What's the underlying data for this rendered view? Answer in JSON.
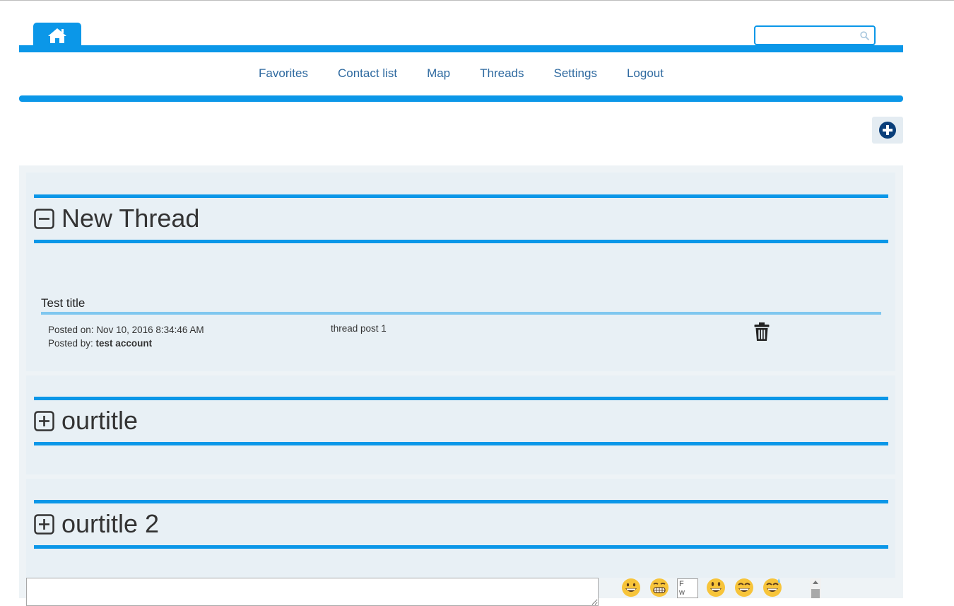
{
  "header": {
    "home_icon": "home-icon",
    "search": {
      "placeholder": "",
      "value": "",
      "icon": "search-icon"
    }
  },
  "nav": {
    "items": [
      {
        "label": "Favorites"
      },
      {
        "label": "Contact list"
      },
      {
        "label": "Map"
      },
      {
        "label": "Threads"
      },
      {
        "label": "Settings"
      },
      {
        "label": "Logout"
      }
    ]
  },
  "toolbar": {
    "add_icon": "plus-circle-icon"
  },
  "threads": [
    {
      "title": "New Thread",
      "expanded": true,
      "toggle_icon": "minus-square-icon",
      "posts": [
        {
          "title": "Test title",
          "posted_on_label": "Posted on: ",
          "posted_on": "Nov 10, 2016 8:34:46 AM",
          "posted_by_label": "Posted by: ",
          "posted_by": "test account",
          "body": "thread post 1",
          "delete_icon": "trash-icon"
        }
      ]
    },
    {
      "title": "ourtitle",
      "expanded": false,
      "toggle_icon": "plus-square-icon",
      "posts": []
    },
    {
      "title": "ourtitle 2",
      "expanded": false,
      "toggle_icon": "plus-square-icon",
      "posts": []
    }
  ],
  "compose": {
    "value": "",
    "emojis": [
      "grinning-face-icon",
      "grimacing-face-icon",
      "broken-image",
      "smiley-face-icon",
      "smile-face-icon",
      "sweat-smile-face-icon"
    ],
    "broken_image_alt": "F\nw"
  },
  "colors": {
    "accent": "#0b97e8",
    "link": "#2f6aa0",
    "panel": "#e8f0f5",
    "add_icon": "#0a3f7a"
  }
}
